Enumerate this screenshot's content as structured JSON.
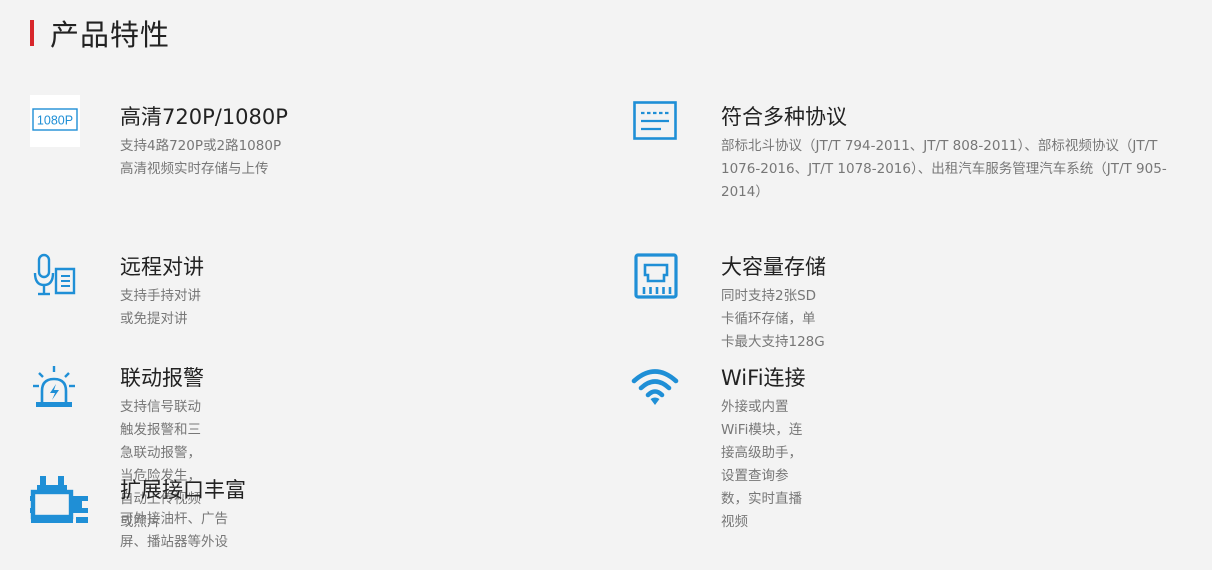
{
  "section": {
    "title": "产品特性"
  },
  "features": [
    {
      "title": "高清720P/1080P",
      "desc": "支持4路720P或2路1080P高清视频实时存储与上传",
      "icon": "1080p-icon",
      "icon_text": "1080P"
    },
    {
      "title": "符合多种协议",
      "desc": "部标北斗协议（JT/T 794-2011、JT/T 808-2011）、部标视频协议（JT/T 1076-2016、JT/T 1078-2016）、出租汽车服务管理汽车系统（JT/T 905-2014）",
      "icon": "protocol-document-icon"
    },
    {
      "title": "远程对讲",
      "desc": "支持手持对讲或免提对讲",
      "icon": "microphone-intercom-icon"
    },
    {
      "title": "大容量存储",
      "desc": "同时支持2张SD卡循环存储，单卡最大支持128G",
      "icon": "sd-card-icon"
    },
    {
      "title": "联动报警",
      "desc": "支持信号联动触发报警和三急联动报警，当危险发生，自动上传视频或照片",
      "icon": "alarm-light-icon"
    },
    {
      "title": "WiFi连接",
      "desc": "外接或内置WiFi模块，连接高级助手，设置查询参数，实时直播视频",
      "icon": "wifi-icon"
    },
    {
      "title": "扩展接口丰富",
      "desc": "可外接油杆、广告屏、播站器等外设",
      "icon": "expansion-interface-icon"
    }
  ],
  "colors": {
    "accent": "#d7262b",
    "icon_blue": "#1f8fd6",
    "title_text": "#222222",
    "desc_text": "#777777",
    "background": "#f3f3f3"
  }
}
